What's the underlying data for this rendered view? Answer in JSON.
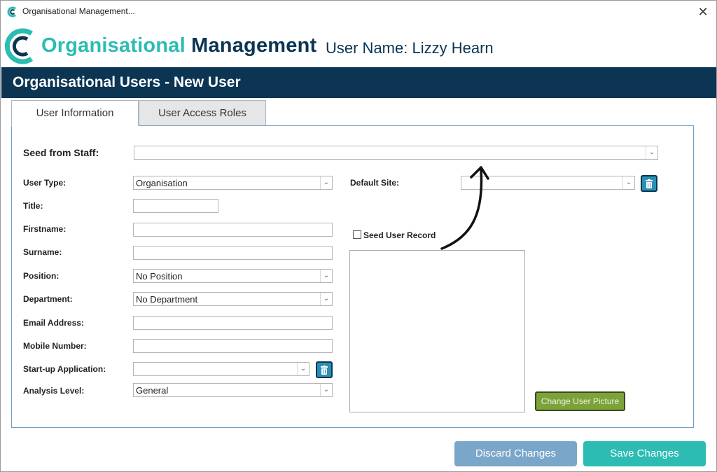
{
  "window": {
    "title": "Organisational Management...",
    "close_glyph": "✕",
    "icon": "app-logo-icon"
  },
  "header": {
    "brand_part1": "Organisational",
    "brand_part2": "Management",
    "user_name": "User Name: Lizzy Hearn",
    "colors": {
      "teal": "#2bbcb3",
      "navy": "#0b3553"
    }
  },
  "page": {
    "title": "Organisational Users - New User"
  },
  "tabs": [
    {
      "label": "User Information",
      "active": true
    },
    {
      "label": "User Access Roles",
      "active": false
    }
  ],
  "form": {
    "seed_from_staff": {
      "label": "Seed from Staff:",
      "value": ""
    },
    "user_type": {
      "label": "User Type:",
      "value": "Organisation"
    },
    "title": {
      "label": "Title:",
      "value": ""
    },
    "firstname": {
      "label": "Firstname:",
      "value": ""
    },
    "surname": {
      "label": "Surname:",
      "value": ""
    },
    "position": {
      "label": "Position:",
      "value": "No Position"
    },
    "department": {
      "label": "Department:",
      "value": "No Department"
    },
    "email": {
      "label": "Email Address:",
      "value": ""
    },
    "mobile": {
      "label": "Mobile Number:",
      "value": ""
    },
    "startup_app": {
      "label": "Start-up Application:",
      "value": ""
    },
    "analysis_level": {
      "label": "Analysis Level:",
      "value": "General"
    },
    "default_site": {
      "label": "Default Site:",
      "value": ""
    },
    "seed_user_record": {
      "label": "Seed User Record",
      "checked": false
    }
  },
  "buttons": {
    "change_picture": "Change User Picture",
    "discard": "Discard Changes",
    "save": "Save Changes",
    "colors": {
      "discard": "#7aa6c9",
      "save": "#2cbcb3",
      "change_picture": "#7ca33a"
    }
  },
  "icons": {
    "clear": "trash-icon",
    "dropdown": "chevron-down-icon",
    "annotation": "curved-arrow-icon"
  }
}
